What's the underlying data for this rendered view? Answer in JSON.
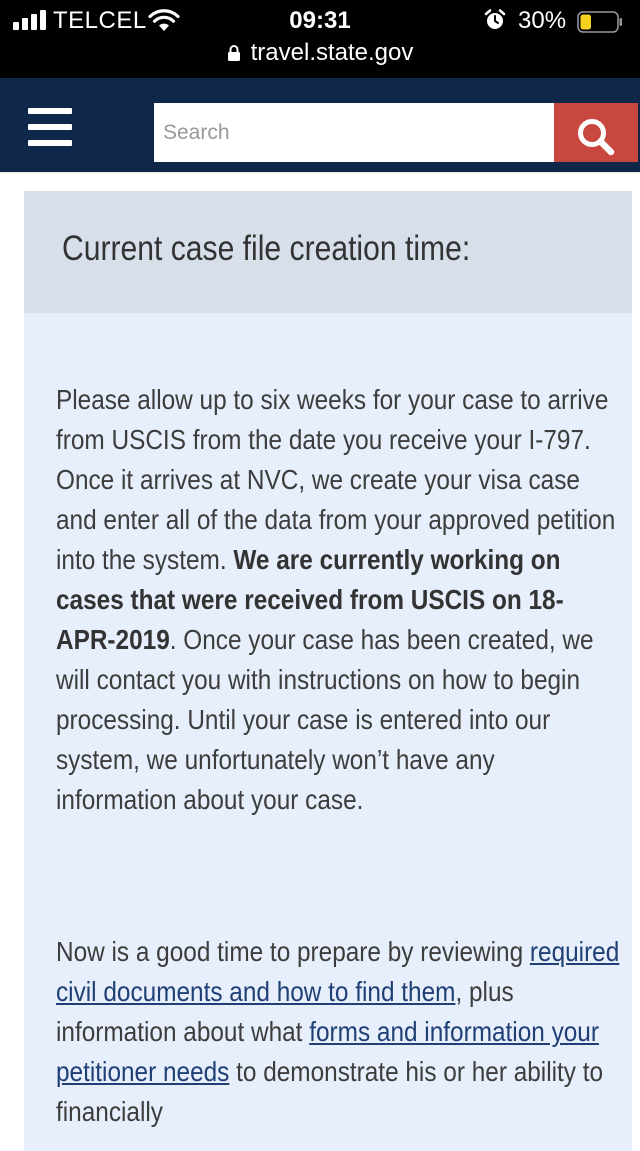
{
  "status_bar": {
    "carrier": "TELCEL",
    "time": "09:31",
    "battery_percent": "30%",
    "battery_level": 0.3,
    "url": "travel.state.gov",
    "icons": [
      "signal-icon",
      "wifi-icon",
      "alarm-icon",
      "battery-icon",
      "lock-icon"
    ]
  },
  "navbar": {
    "background": "#0f2748",
    "search_placeholder": "Search",
    "search_value": "",
    "search_button_color": "#c8473e",
    "icons": [
      "menu-icon",
      "search-icon"
    ]
  },
  "card": {
    "title": "Current case file creation time:",
    "paragraph1": {
      "text_before": "Please allow up to six weeks for your case to arrive from USCIS from the date you receive your I-797. Once it arrives at NVC, we create your visa case and enter all of the data from your approved petition into the system. ",
      "bold": "We are currently working on cases that were received from USCIS on 18-APR-2019",
      "text_after": ". Once your case has been created, we will contact you with instructions on how to begin processing. Until your case is entered into our system, we unfortunately won’t have any information about your case."
    },
    "paragraph2": {
      "text_before": "Now is a good time to prepare by reviewing ",
      "link1": "required civil documents and how to find them",
      "text_middle": ", plus information about what ",
      "link2": "forms and information your petitioner needs",
      "text_after": " to demonstrate his or her ability to financially"
    }
  }
}
